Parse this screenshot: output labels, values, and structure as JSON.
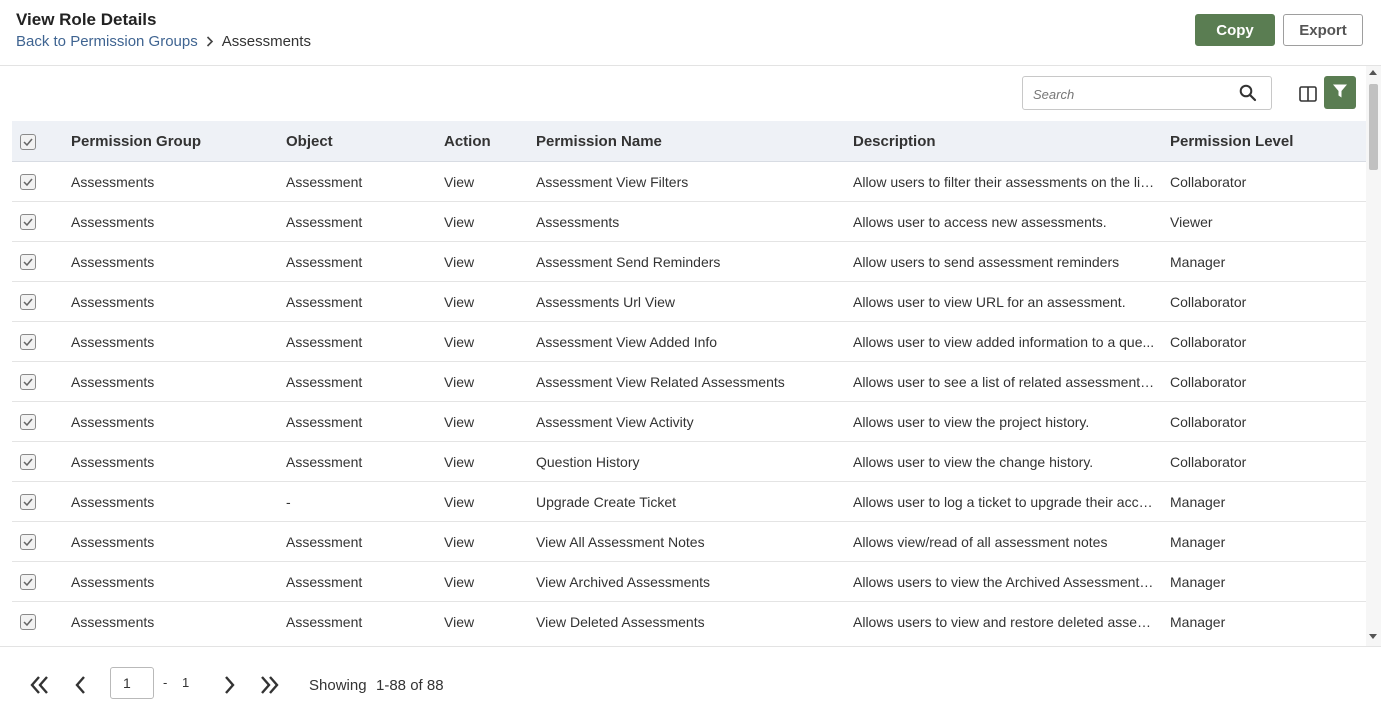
{
  "header": {
    "title": "View Role Details",
    "breadcrumb_link": "Back to Permission Groups",
    "breadcrumb_current": "Assessments",
    "copy_label": "Copy",
    "export_label": "Export"
  },
  "toolbar": {
    "search_placeholder": "Search"
  },
  "table": {
    "columns": [
      "Permission Group",
      "Object",
      "Action",
      "Permission Name",
      "Description",
      "Permission Level"
    ],
    "rows": [
      {
        "group": "Assessments",
        "object": "Assessment",
        "action": "View",
        "name": "Assessment View Filters",
        "desc": "Allow users to filter their assessments on the lis...",
        "level": "Collaborator",
        "checked": true
      },
      {
        "group": "Assessments",
        "object": "Assessment",
        "action": "View",
        "name": "Assessments",
        "desc": "Allows user to access new assessments.",
        "level": "Viewer",
        "checked": true
      },
      {
        "group": "Assessments",
        "object": "Assessment",
        "action": "View",
        "name": "Assessment Send Reminders",
        "desc": "Allow users to send assessment reminders",
        "level": "Manager",
        "checked": true
      },
      {
        "group": "Assessments",
        "object": "Assessment",
        "action": "View",
        "name": "Assessments Url View",
        "desc": "Allows user to view URL for an assessment.",
        "level": "Collaborator",
        "checked": true
      },
      {
        "group": "Assessments",
        "object": "Assessment",
        "action": "View",
        "name": "Assessment View Added Info",
        "desc": "Allows user to view added information to a que...",
        "level": "Collaborator",
        "checked": true
      },
      {
        "group": "Assessments",
        "object": "Assessment",
        "action": "View",
        "name": "Assessment View Related Assessments",
        "desc": "Allows user to see a list of related assessments. ...",
        "level": "Collaborator",
        "checked": true
      },
      {
        "group": "Assessments",
        "object": "Assessment",
        "action": "View",
        "name": "Assessment View Activity",
        "desc": "Allows user to view the project history.",
        "level": "Collaborator",
        "checked": true
      },
      {
        "group": "Assessments",
        "object": "Assessment",
        "action": "View",
        "name": "Question History",
        "desc": "Allows user to view the change history.",
        "level": "Collaborator",
        "checked": true
      },
      {
        "group": "Assessments",
        "object": "-",
        "action": "View",
        "name": "Upgrade Create Ticket",
        "desc": "Allows user to log a ticket to upgrade their acco...",
        "level": "Manager",
        "checked": true
      },
      {
        "group": "Assessments",
        "object": "Assessment",
        "action": "View",
        "name": "View All Assessment Notes",
        "desc": "Allows view/read of all assessment notes",
        "level": "Manager",
        "checked": true
      },
      {
        "group": "Assessments",
        "object": "Assessment",
        "action": "View",
        "name": "View Archived Assessments",
        "desc": "Allows users to view the Archived Assessments ...",
        "level": "Manager",
        "checked": true
      },
      {
        "group": "Assessments",
        "object": "Assessment",
        "action": "View",
        "name": "View Deleted Assessments",
        "desc": "Allows users to view and restore deleted assess...",
        "level": "Manager",
        "checked": true
      }
    ]
  },
  "pagination": {
    "current_page": "1",
    "separator": "-",
    "total_pages": "1",
    "showing_label": "Showing",
    "range": "1-88 of 88"
  },
  "colors": {
    "accent_green": "#5a7d52",
    "link_blue": "#3f6491",
    "header_bg": "#eef1f6"
  },
  "icons": {
    "search": "search-icon",
    "columns": "columns-icon",
    "filter": "filter-icon",
    "first_page": "double-chevron-left-icon",
    "prev_page": "chevron-left-icon",
    "next_page": "chevron-right-icon",
    "last_page": "double-chevron-right-icon",
    "checkbox": "checkbox-checked-icon"
  }
}
